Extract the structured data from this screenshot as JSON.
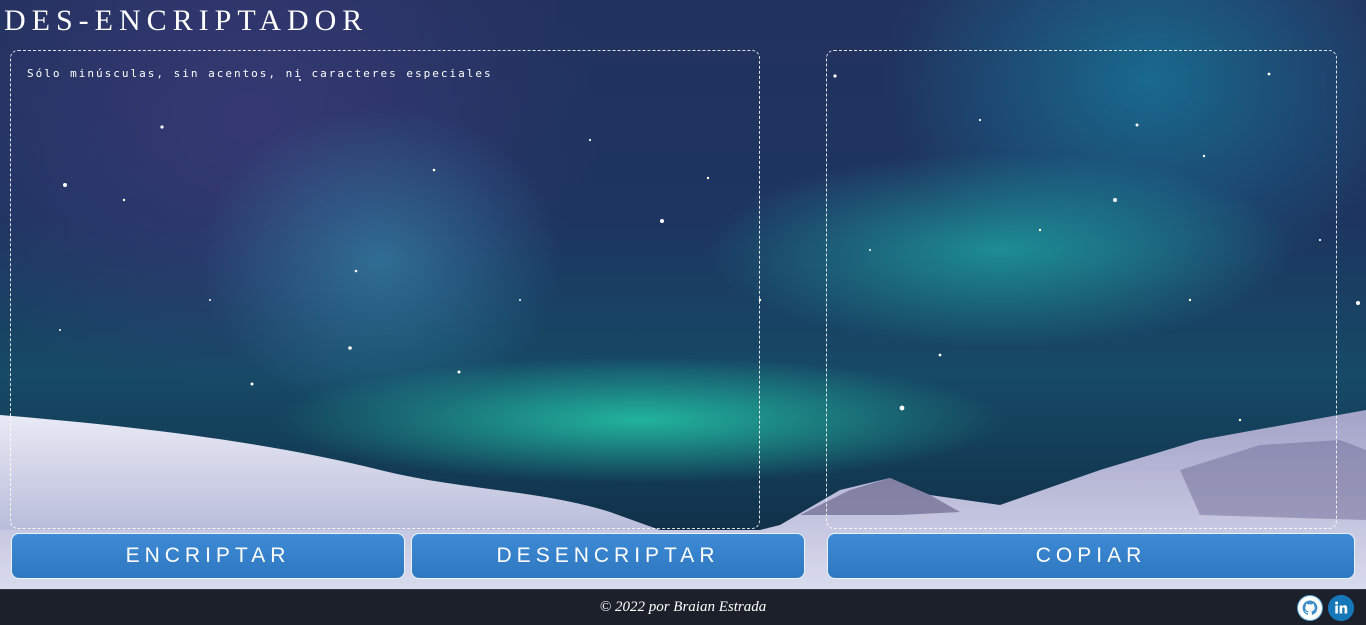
{
  "header": {
    "title": "DES-ENCRIPTADOR"
  },
  "input_panel": {
    "placeholder": "Sólo minúsculas, sin acentos, ni caracteres especiales",
    "value": ""
  },
  "output_panel": {
    "value": ""
  },
  "actions": {
    "encrypt_label": "ENCRIPTAR",
    "decrypt_label": "DESENCRIPTAR",
    "copy_label": "COPIAR"
  },
  "footer": {
    "credit": "© 2022 por Braian Estrada",
    "links": [
      {
        "icon": "github-icon",
        "color": "#5aa6d8"
      },
      {
        "icon": "linkedin-icon",
        "color": "#1577b8"
      }
    ]
  },
  "colors": {
    "button": "#3583cc",
    "footer": "#1e202a",
    "text": "#ffffff"
  }
}
